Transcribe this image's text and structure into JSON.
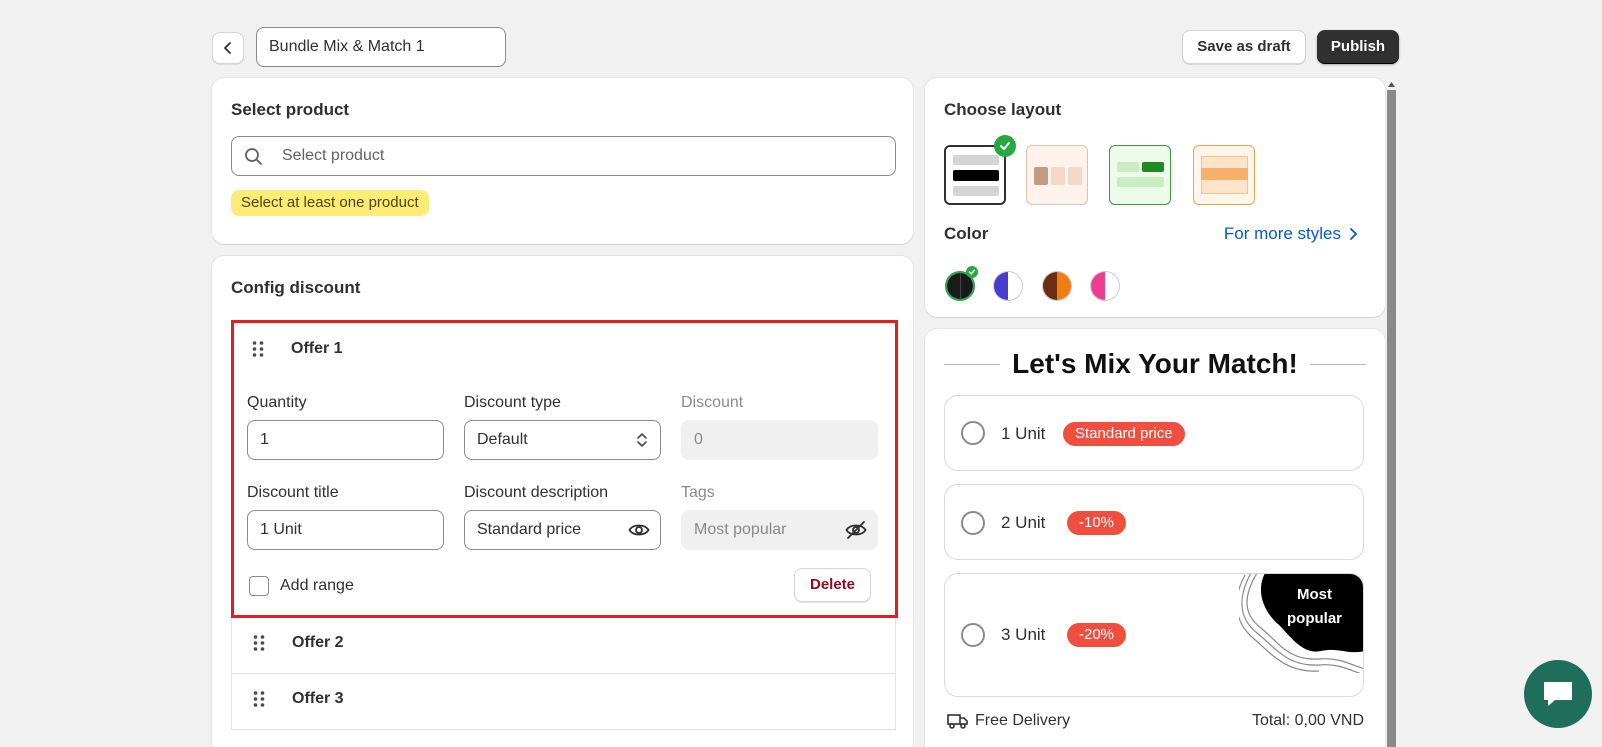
{
  "header": {
    "title_value": "Bundle Mix & Match 1",
    "save_draft_label": "Save as draft",
    "publish_label": "Publish"
  },
  "select_product": {
    "title": "Select product",
    "search_placeholder": "Select product",
    "warning": "Select at least one product"
  },
  "config": {
    "title": "Config discount",
    "offer1": {
      "title": "Offer 1",
      "quantity_label": "Quantity",
      "quantity_value": "1",
      "discount_type_label": "Discount type",
      "discount_type_value": "Default",
      "discount_label": "Discount",
      "discount_value": "0",
      "discount_title_label": "Discount title",
      "discount_title_value": "1 Unit",
      "discount_desc_label": "Discount description",
      "discount_desc_value": "Standard price",
      "tags_label": "Tags",
      "tags_placeholder": "Most popular",
      "add_range_label": "Add range",
      "delete_label": "Delete"
    },
    "offer2_title": "Offer 2",
    "offer3_title": "Offer 3"
  },
  "layout": {
    "title": "Choose layout",
    "color_title": "Color",
    "more_styles": "For more styles",
    "colors": [
      {
        "left": "#1a1a1a",
        "right": "#1a1a1a",
        "ring": "#29a745"
      },
      {
        "left": "#4b3ccf",
        "right": "#ffffff"
      },
      {
        "left": "#6b2e10",
        "right": "#f07d12"
      },
      {
        "left": "#ee3d8f",
        "right": "#ffffff"
      }
    ]
  },
  "preview": {
    "title": "Let's Mix Your Match!",
    "options": [
      {
        "unit": "1 Unit",
        "badge": "Standard price"
      },
      {
        "unit": "2 Unit",
        "badge": "-10%"
      },
      {
        "unit": "3 Unit",
        "badge": "-20%",
        "ribbon_line1": "Most",
        "ribbon_line2": "popular"
      }
    ],
    "delivery": "Free Delivery",
    "total": "Total: 0,00 VND"
  }
}
